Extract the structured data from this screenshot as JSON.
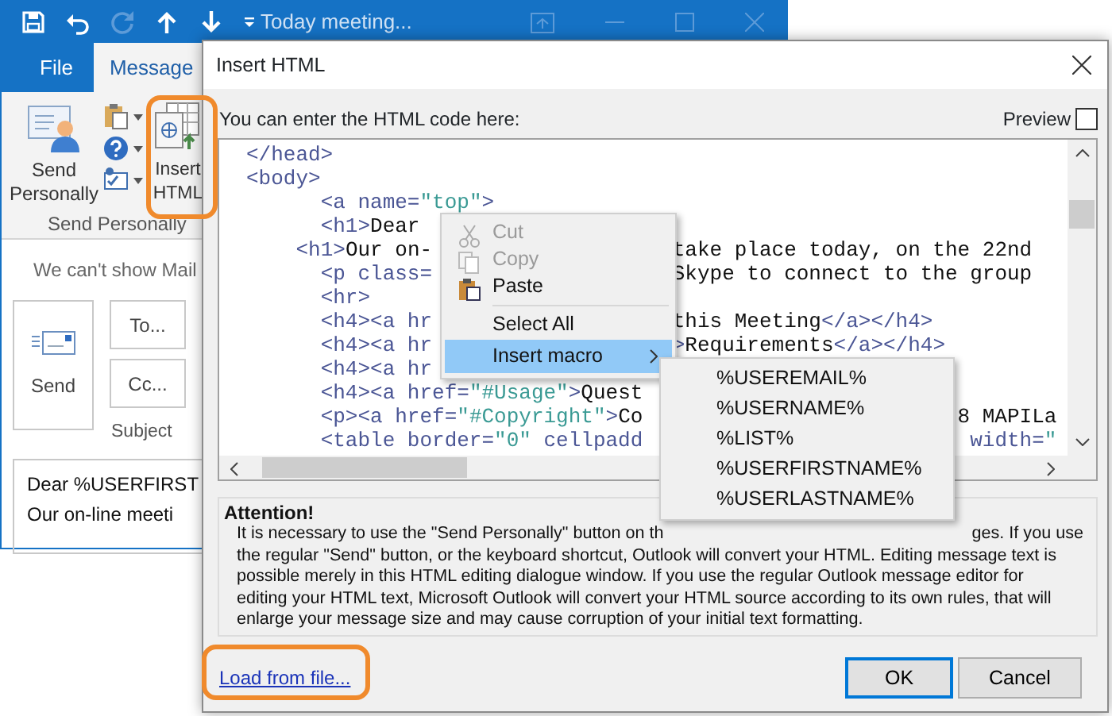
{
  "outlook_window": {
    "title": "Today meeting...",
    "tabs": [
      {
        "label": "File",
        "selected": false
      },
      {
        "label": "Message",
        "selected": true
      }
    ],
    "ribbon": {
      "buttons": [
        {
          "label": "Send Personally",
          "highlighted": false
        },
        {
          "label": "Insert HTML",
          "highlighted": true
        }
      ],
      "group_label": "Send Personally"
    },
    "info_bar": "We can't show Mail",
    "compose": {
      "send": "Send",
      "to": "To...",
      "cc": "Cc...",
      "subject_label": "Subject",
      "body_lines": [
        "Dear %USERFIRST",
        "Our on-line meeti"
      ]
    }
  },
  "dialog": {
    "title": "Insert HTML",
    "prompt": "You can enter the HTML code here:",
    "preview": {
      "label": "Preview",
      "checked": false
    },
    "code_lines": [
      {
        "left": "</head>"
      },
      {
        "left": "<body>"
      },
      {
        "left": "      <a name=\"top\">"
      },
      {
        "left": "      <h1>Dear"
      },
      {
        "left": "    <h1>Our on-",
        "right": "take place today, on the 22nd"
      },
      {
        "left": "      <p class=",
        "right": "Skype to connect to the group"
      },
      {
        "left": "      <hr>"
      },
      {
        "left": "      <h4><a hr",
        "right": "this Meeting</a></h4>"
      },
      {
        "left": "      <h4><a hr",
        "right": ">Requirements</a></h4>"
      },
      {
        "left": "      <h4><a hr"
      },
      {
        "left": "      <h4><a href=\"#Usage\">Quest"
      },
      {
        "left": "      <p><a href=\"#Copyright\">Co",
        "right": "8 MAPILa"
      },
      {
        "left": "      <table border=\"0\" cellpadd",
        "right": "width=\""
      }
    ],
    "attention": {
      "title": "Attention!",
      "first_line_left": "It is necessary to use the \"Send Personally\" button on th",
      "first_line_right": "ges. If you use",
      "lines": [
        "the regular \"Send\" button, or the keyboard shortcut, Outlook will convert your HTML. Editing message text is",
        "possible merely in this HTML editing dialogue window. If you use the regular Outlook message editor for",
        "editing your HTML text, Microsoft Outlook will convert your HTML source according to its own rules, that will",
        "enlarge your message size and may cause corruption of your initial text formatting."
      ]
    },
    "link": {
      "label": "Load from file...",
      "highlighted": true
    },
    "buttons": [
      {
        "label": "OK",
        "default": true
      },
      {
        "label": "Cancel",
        "default": false
      }
    ]
  },
  "context_menu": {
    "items": [
      {
        "kind": "item",
        "label": "Cut",
        "disabled": true,
        "selected": false,
        "submenu": false
      },
      {
        "kind": "item",
        "label": "Copy",
        "disabled": true,
        "selected": false,
        "submenu": false
      },
      {
        "kind": "item",
        "label": "Paste",
        "disabled": false,
        "selected": false,
        "submenu": false
      },
      {
        "kind": "separator"
      },
      {
        "kind": "item",
        "label": "Select All",
        "disabled": false,
        "selected": false,
        "submenu": false
      },
      {
        "kind": "item",
        "label": "Insert macro",
        "disabled": false,
        "selected": true,
        "submenu": true
      }
    ]
  },
  "submenu": {
    "items": [
      "%USEREMAIL%",
      "%USERNAME%",
      "%LIST%",
      "%USERFIRSTNAME%",
      "%USERLASTNAME%"
    ]
  }
}
